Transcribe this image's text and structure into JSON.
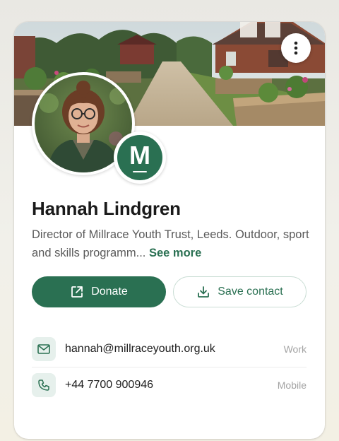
{
  "profile": {
    "name": "Hannah Lindgren",
    "bio": "Director of Millrace Youth Trust, Leeds. Outdoor, sport and skills programm...",
    "see_more": "See more",
    "logo_letter": "M"
  },
  "actions": {
    "donate_label": "Donate",
    "save_contact_label": "Save contact"
  },
  "contacts": [
    {
      "value": "hannah@millraceyouth.org.uk",
      "type": "Work",
      "icon": "mail-icon"
    },
    {
      "value": "+44 7700 900946",
      "type": "Mobile",
      "icon": "phone-icon"
    }
  ],
  "colors": {
    "accent": "#2a7052",
    "accent_light": "#e6f0ec",
    "muted_text": "#5a5a5a"
  }
}
